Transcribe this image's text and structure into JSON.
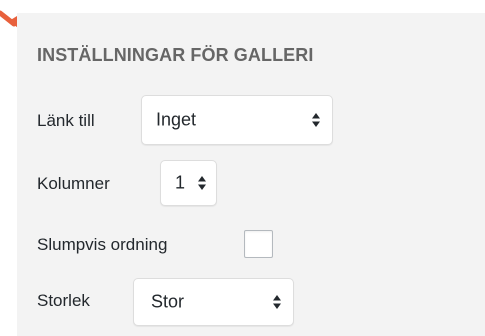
{
  "colors": {
    "panel_background": "#f3f3f3",
    "heading_text": "#666666",
    "label_text": "#23282d",
    "arrow_accent": "#e8603c"
  },
  "gallery_settings": {
    "heading": "INSTÄLLNINGAR FÖR GALLERI",
    "link_to": {
      "label": "Länk till",
      "selected": "Inget"
    },
    "columns": {
      "label": "Kolumner",
      "selected": "1"
    },
    "random_order": {
      "label": "Slumpvis ordning",
      "checked": false
    },
    "size": {
      "label": "Storlek",
      "selected": "Stor"
    }
  },
  "icons": {
    "pointer": "arrow-pointer-icon",
    "select_indicator": "updown-chevron-icon"
  }
}
